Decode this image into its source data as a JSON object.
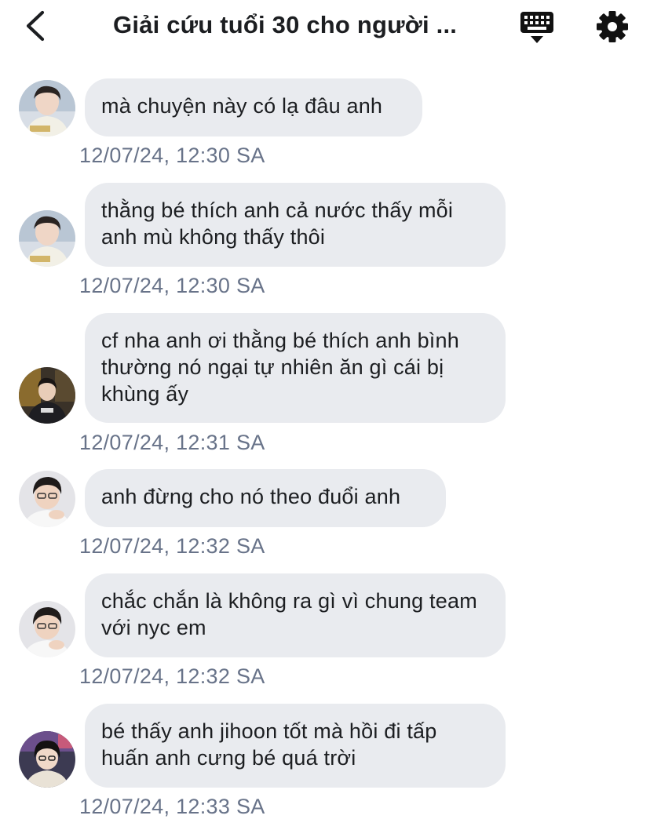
{
  "header": {
    "title": "Giải cứu tuổi 30 cho người ...",
    "back_icon": "chevron-left-icon",
    "keyboard_icon": "keyboard-icon",
    "settings_icon": "gear-icon"
  },
  "colors": {
    "bubble_bg": "#e9ebef",
    "timestamp": "#687389",
    "text": "#1c1e21"
  },
  "messages": [
    {
      "text": "mà chuyện này có lạ đâu anh",
      "time": "12/07/24, 12:30 SA"
    },
    {
      "text": "thằng bé thích anh cả nước thấy mỗi anh mù không thấy thôi",
      "time": "12/07/24, 12:30 SA"
    },
    {
      "text": "cf nha anh ơi thằng bé thích anh bình thường nó ngại tự nhiên ăn gì cái bị khùng ấy",
      "time": "12/07/24, 12:31 SA"
    },
    {
      "text": "anh đừng cho nó theo đuổi anh",
      "time": "12/07/24, 12:32 SA"
    },
    {
      "text": "chắc chắn là không ra gì vì chung team với nyc em",
      "time": "12/07/24, 12:32 SA"
    },
    {
      "text": "bé thấy anh jihoon tốt mà hồi đi tấp huấn anh cưng bé quá trời",
      "time": "12/07/24, 12:33 SA"
    }
  ]
}
